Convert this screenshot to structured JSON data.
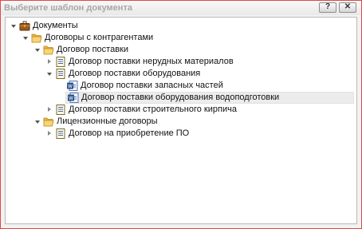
{
  "dialog": {
    "title": "Выберите шаблон документа",
    "help_button": "?",
    "close_button": "✕"
  },
  "tree": {
    "root": "Документы",
    "contracts_folder": "Договоры с контрагентами",
    "supply_folder": "Договор поставки",
    "item_bulk_materials": "Договор поставки нерудных материалов",
    "item_equipment": "Договор поставки оборудования",
    "item_spare_parts": "Договор поставки запасных частей",
    "item_water_treatment": "Договор поставки оборудования водоподготовки",
    "item_bricks": "Договор поставки строительного кирпича",
    "license_folder": "Лицензионные договоры",
    "item_software": "Договор на приобретение ПО",
    "selected_item": "Договор поставки оборудования водоподготовки"
  }
}
